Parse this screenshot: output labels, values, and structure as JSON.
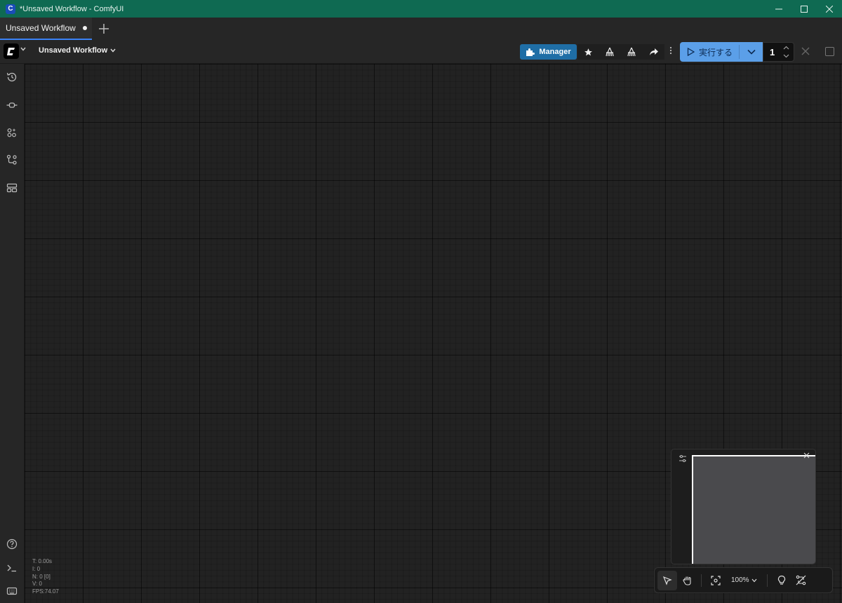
{
  "window": {
    "title": "*Unsaved Workflow - ComfyUI",
    "app_icon_letter": "C",
    "minimize": "—",
    "maximize": "☐",
    "close": "✕"
  },
  "tabs": [
    {
      "label": "Unsaved Workflow",
      "modified": true
    }
  ],
  "toolbar": {
    "workflow_name": "Unsaved Workflow",
    "manager_label": "Manager",
    "run_label": "実行する",
    "batch_count": "1"
  },
  "stats": {
    "t": "T: 0.00s",
    "i": "I: 0",
    "n": "N: 0 [0]",
    "v": "V: 0",
    "fps": "FPS:74.07"
  },
  "canvas_controls": {
    "zoom": "100%"
  },
  "colors": {
    "titlebar": "#0f6a52",
    "manager_button": "#1f6ea6",
    "run_button": "#5b9fe8",
    "active_tab_underline": "#3b82f6"
  }
}
